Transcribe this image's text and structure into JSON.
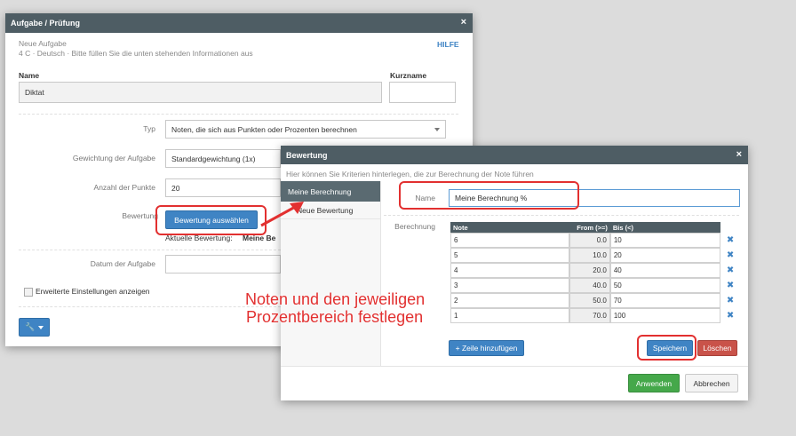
{
  "dialog1": {
    "title": "Aufgabe / Prüfung",
    "close": "×",
    "subtitle": "Neue Aufgabe",
    "info": "4 C · Deutsch · Bitte füllen Sie die unten stehenden Informationen aus",
    "help": "HILFE",
    "name_label": "Name",
    "name_value": "Diktat",
    "short_label": "Kurzname",
    "short_value": "",
    "type_label": "Typ",
    "type_value": "Noten, die sich aus Punkten oder Prozenten berechnen",
    "weight_label": "Gewichtung der Aufgabe",
    "weight_value": "Standardgewichtung (1x)",
    "points_label": "Anzahl der Punkte",
    "points_value": "20",
    "rating_label": "Bewertung",
    "rating_button": "Bewertung auswählen",
    "current_label": "Aktuelle Bewertung:",
    "current_value": "Meine Be",
    "date_label": "Datum der Aufgabe",
    "advanced_label": "Erweiterte Einstellungen anzeigen",
    "tools_icon": "wrench-icon"
  },
  "dialog2": {
    "title": "Bewertung",
    "close": "×",
    "info": "Hier können Sie Kriterien hinterlegen, die zur Berechnung der Note führen",
    "sidebar": [
      {
        "label": "Meine Berechnung",
        "active": true
      },
      {
        "label": "Neue Bewertung",
        "active": false
      }
    ],
    "name_label": "Name",
    "name_value": "Meine Berechnung %",
    "calc_label": "Berechnung",
    "table": {
      "headers": [
        "Note",
        "From (>=)",
        "Bis (<)"
      ],
      "rows": [
        {
          "note": "6",
          "from": "0.0",
          "to": "10"
        },
        {
          "note": "5",
          "from": "10.0",
          "to": "20"
        },
        {
          "note": "4",
          "from": "20.0",
          "to": "40"
        },
        {
          "note": "3",
          "from": "40.0",
          "to": "50"
        },
        {
          "note": "2",
          "from": "50.0",
          "to": "70"
        },
        {
          "note": "1",
          "from": "70.0",
          "to": "100"
        }
      ],
      "delete_symbol": "✖"
    },
    "add_row": "+ Zeile hinzufügen",
    "save": "Speichern",
    "delete": "Löschen",
    "apply": "Anwenden",
    "cancel": "Abbrechen"
  },
  "annotation": {
    "line1": "Noten und den jeweiligen",
    "line2": "Prozentbereich festlegen",
    "color": "#e23030"
  },
  "colors": {
    "titlebar": "#4e5d64",
    "primary": "#3f84c4",
    "danger": "#c9534a",
    "success": "#45a84a"
  }
}
